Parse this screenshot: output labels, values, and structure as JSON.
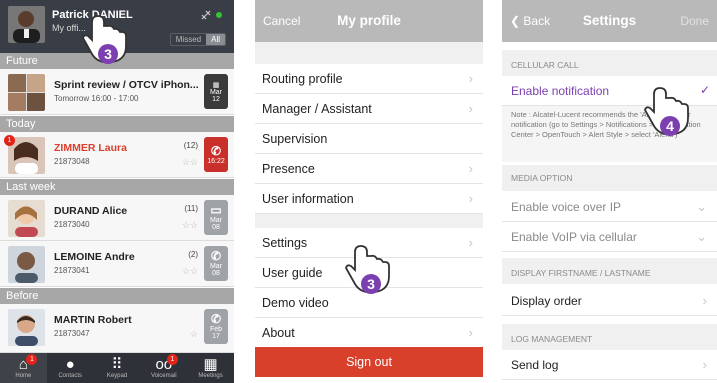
{
  "screen1": {
    "header": {
      "name": "Patrick DANIEL",
      "status": "My offi...",
      "filter": [
        "Missed",
        "All"
      ]
    },
    "sections": {
      "future": "Future",
      "today": "Today",
      "last_week": "Last week",
      "before": "Before"
    },
    "entries": [
      {
        "name": "Sprint review / OTCV iPhon...",
        "sub": "Tomorrow 16:00 - 17:00",
        "tile_line1": "Mar",
        "tile_line2": "12",
        "tile_color": "#3a3a3a"
      },
      {
        "name": "ZIMMER Laura",
        "sub": "21873048",
        "count": "(12)",
        "tile_line2": "16:22",
        "tile_color": "#c9302c",
        "badge": "1"
      },
      {
        "name": "DURAND Alice",
        "sub": "21873040",
        "count": "(11)",
        "tile_line1": "Mar",
        "tile_line2": "08",
        "tile_color": "#9fa3a8"
      },
      {
        "name": "LEMOINE Andre",
        "sub": "21873041",
        "count": "(2)",
        "tile_line1": "Mar",
        "tile_line2": "08",
        "tile_color": "#9fa3a8"
      },
      {
        "name": "MARTIN Robert",
        "sub": "21873047",
        "tile_line1": "Feb",
        "tile_line2": "17",
        "tile_color": "#9fa3a8"
      }
    ],
    "tabs": [
      {
        "icon": "home-icon",
        "label": "Home",
        "badge": "1"
      },
      {
        "icon": "contacts-icon",
        "label": "Contacts"
      },
      {
        "icon": "keypad-icon",
        "label": "Keypad"
      },
      {
        "icon": "voicemail-icon",
        "label": "Voicemail",
        "badge": "1"
      },
      {
        "icon": "meetings-icon",
        "label": "Meetings"
      }
    ],
    "step": "3"
  },
  "screen2": {
    "nav": {
      "left": "Cancel",
      "title": "My profile"
    },
    "group1": [
      "Routing profile",
      "Manager / Assistant",
      "Supervision",
      "Presence",
      "User information"
    ],
    "group2": [
      "Settings",
      "User guide",
      "Demo video",
      "About"
    ],
    "signout": "Sign out",
    "step": "3"
  },
  "screen3": {
    "nav": {
      "left": "Back",
      "title": "Settings",
      "right": "Done"
    },
    "cellular_header": "CELLULAR CALL",
    "enable_notification": "Enable notification",
    "note": "Note : Alcatel-Lucent recommends the 'Alerts' style for notification (go to Settings > Notifications > In Notification Center > OpenTouch > Alert Style > select 'Alerts')",
    "media_header": "MEDIA OPTION",
    "voice_over_ip": "Enable voice over IP",
    "voip_cellular": "Enable VoIP via cellular",
    "display_header": "DISPLAY FIRSTNAME / LASTNAME",
    "display_order": "Display order",
    "log_header": "LOG MANAGEMENT",
    "send_log": "Send log",
    "step": "4"
  },
  "colors": {
    "accent": "#7b3fb0",
    "signout": "#d9402b",
    "dark": "#393d45"
  }
}
